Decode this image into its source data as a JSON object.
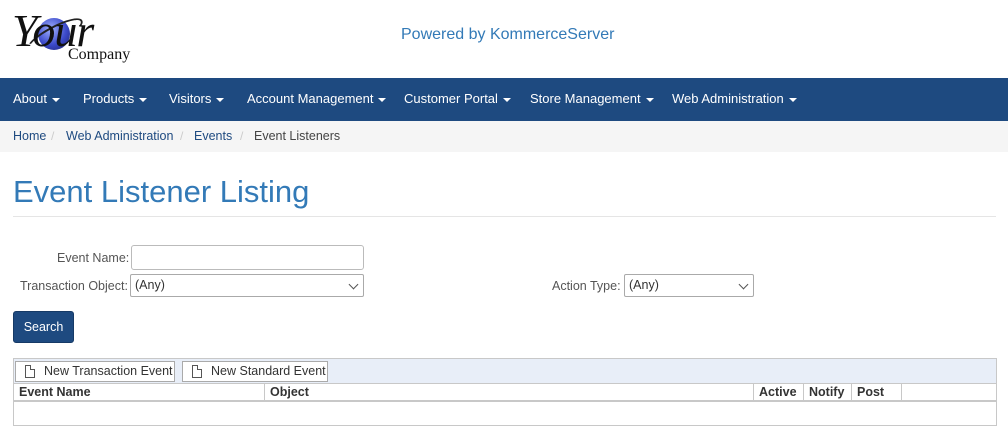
{
  "header": {
    "logo_word": "Your",
    "logo_sub": "Company",
    "powered_by": "Powered by KommerceServer"
  },
  "nav": {
    "items": [
      {
        "label": "About"
      },
      {
        "label": "Products"
      },
      {
        "label": "Visitors"
      },
      {
        "label": "Account Management"
      },
      {
        "label": "Customer Portal"
      },
      {
        "label": "Store Management"
      },
      {
        "label": "Web Administration"
      }
    ]
  },
  "breadcrumb": {
    "items": [
      {
        "label": "Home"
      },
      {
        "label": "Web Administration"
      },
      {
        "label": "Events"
      },
      {
        "label": "Event Listeners"
      }
    ],
    "separator": "/"
  },
  "page": {
    "title": "Event Listener Listing"
  },
  "form": {
    "event_name_label": "Event Name:",
    "event_name_value": "",
    "transaction_object_label": "Transaction Object:",
    "transaction_object_value": "(Any)",
    "action_type_label": "Action Type:",
    "action_type_value": "(Any)",
    "search_label": "Search"
  },
  "grid": {
    "toolbar": {
      "new_transaction_label": "New Transaction Event",
      "new_standard_label": "New Standard Event"
    },
    "columns": [
      {
        "label": "Event Name"
      },
      {
        "label": "Object"
      },
      {
        "label": "Active"
      },
      {
        "label": "Notify"
      },
      {
        "label": "Post"
      },
      {
        "label": ""
      }
    ],
    "rows": []
  }
}
